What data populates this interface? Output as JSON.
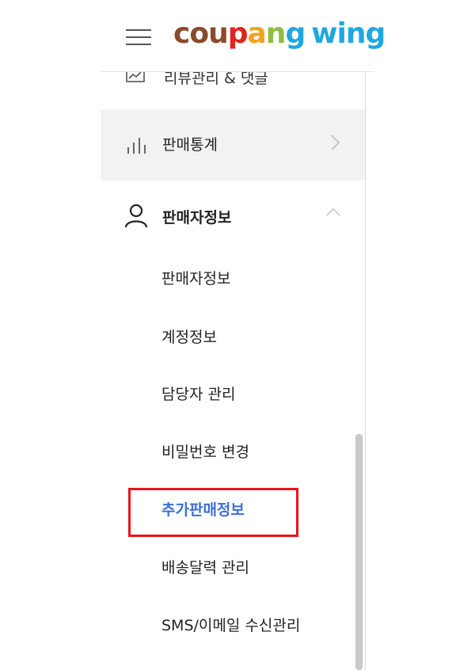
{
  "header": {
    "logo_coupang": "coupang",
    "logo_wing": "wing",
    "logo_colors": [
      "#8b4a2b",
      "#e1241f",
      "#f4a11c",
      "#8cbd3f",
      "#21a7e0"
    ]
  },
  "sidebar": {
    "partial_item": {
      "label": "리뷰관리 & 댓글",
      "icon": "review-icon"
    },
    "items": [
      {
        "label": "판매통계",
        "icon": "bar-chart-icon",
        "expanded": false
      },
      {
        "label": "판매자정보",
        "icon": "user-icon",
        "expanded": true
      }
    ],
    "sub_items": [
      {
        "label": "판매자정보",
        "active": false
      },
      {
        "label": "계정정보",
        "active": false
      },
      {
        "label": "담당자 관리",
        "active": false
      },
      {
        "label": "비밀번호 변경",
        "active": false
      },
      {
        "label": "추가판매정보",
        "active": true
      },
      {
        "label": "배송달력 관리",
        "active": false
      },
      {
        "label": "SMS/이메일 수신관리",
        "active": false
      }
    ]
  },
  "colors": {
    "active_text": "#3d6fd8",
    "highlight_border": "#e8141b",
    "hover_bg": "#f2f2f2"
  }
}
